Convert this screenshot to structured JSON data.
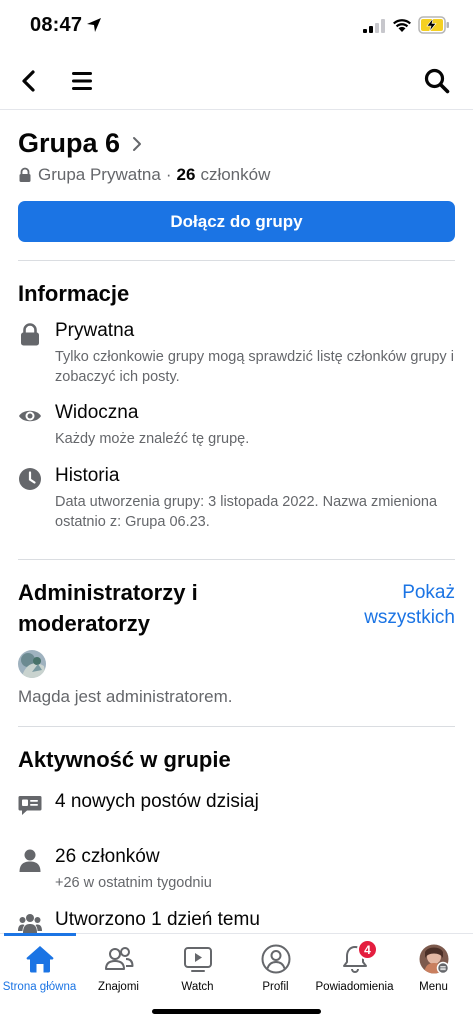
{
  "status_bar": {
    "time": "08:47"
  },
  "group": {
    "name": "Grupa 6",
    "privacy": "Grupa Prywatna",
    "separator": "·",
    "member_count": "26",
    "member_label": "członków",
    "join_label": "Dołącz do grupy"
  },
  "info": {
    "title": "Informacje",
    "items": [
      {
        "icon": "lock-icon",
        "heading": "Prywatna",
        "desc": "Tylko członkowie grupy mogą sprawdzić listę członków grupy i zobaczyć ich posty."
      },
      {
        "icon": "eye-icon",
        "heading": "Widoczna",
        "desc": "Każdy może znaleźć tę grupę."
      },
      {
        "icon": "clock-icon",
        "heading": "Historia",
        "desc": "Data utworzenia grupy: 3 listopada 2022. Nazwa zmieniona ostatnio z: Grupa 06.23."
      }
    ]
  },
  "admins": {
    "title": "Administratorzy i moderatorzy",
    "show_all": "Pokaż wszystkich",
    "admin_text": "Magda jest administratorem."
  },
  "activity": {
    "title": "Aktywność w grupie",
    "items": [
      {
        "icon": "posts-icon",
        "heading": "4 nowych postów dzisiaj",
        "desc": ""
      },
      {
        "icon": "person-icon",
        "heading": "26 członków",
        "desc": "+26 w ostatnim tygodniu"
      },
      {
        "icon": "group-icon",
        "heading": "Utworzono 1 dzień temu",
        "desc": ""
      }
    ]
  },
  "tabs": [
    {
      "icon": "home-icon",
      "label": "Strona główna",
      "active": true
    },
    {
      "icon": "friends-icon",
      "label": "Znajomi",
      "active": false
    },
    {
      "icon": "watch-icon",
      "label": "Watch",
      "active": false
    },
    {
      "icon": "profile-icon",
      "label": "Profil",
      "active": false
    },
    {
      "icon": "bell-icon",
      "label": "Powiadomienia",
      "active": false
    },
    {
      "icon": "avatar",
      "label": "Menu",
      "active": false
    }
  ],
  "notifications_badge": "4",
  "colors": {
    "accent": "#1b74e4",
    "badge": "#e41e3f",
    "secondary_text": "#65676b"
  }
}
